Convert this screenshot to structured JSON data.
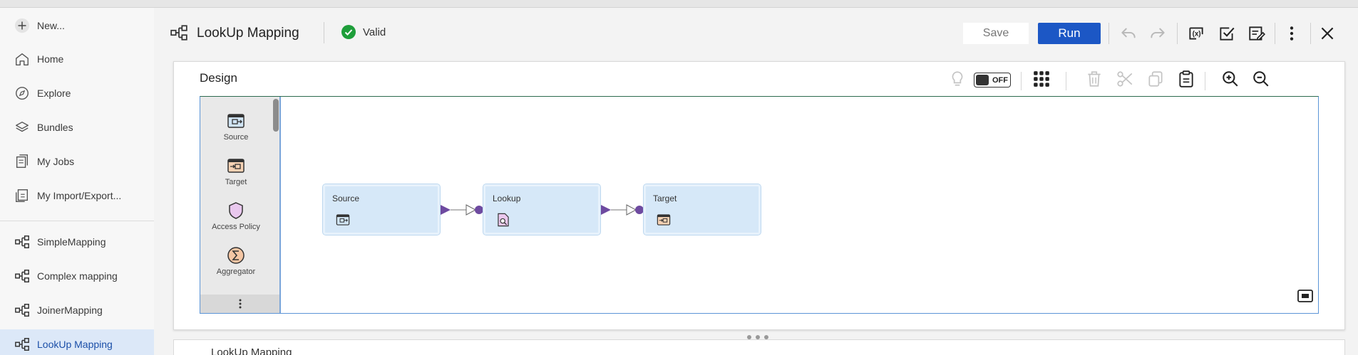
{
  "sidebar": {
    "items": [
      {
        "label": "New...",
        "icon": "plus-icon"
      },
      {
        "label": "Home",
        "icon": "home-icon"
      },
      {
        "label": "Explore",
        "icon": "compass-icon"
      },
      {
        "label": "Bundles",
        "icon": "layers-icon"
      },
      {
        "label": "My Jobs",
        "icon": "jobs-icon"
      },
      {
        "label": "My Import/Export...",
        "icon": "import-export-icon"
      }
    ],
    "mappings": [
      {
        "label": "SimpleMapping",
        "icon": "mapping-icon"
      },
      {
        "label": "Complex mapping",
        "icon": "mapping-icon"
      },
      {
        "label": "JoinerMapping",
        "icon": "mapping-icon"
      },
      {
        "label": "LookUp Mapping",
        "icon": "mapping-icon",
        "active": true
      }
    ]
  },
  "header": {
    "title": "LookUp Mapping",
    "status": "Valid",
    "save_label": "Save",
    "run_label": "Run"
  },
  "design": {
    "title": "Design",
    "toggle_label": "OFF",
    "palette": [
      {
        "label": "Source",
        "icon": "source-icon"
      },
      {
        "label": "Target",
        "icon": "target-icon"
      },
      {
        "label": "Access Policy",
        "icon": "shield-icon"
      },
      {
        "label": "Aggregator",
        "icon": "sigma-icon"
      }
    ],
    "nodes": [
      {
        "label": "Source",
        "icon": "source-icon"
      },
      {
        "label": "Lookup",
        "icon": "lookup-icon"
      },
      {
        "label": "Target",
        "icon": "target-icon"
      }
    ]
  },
  "lower_panel": {
    "title": "LookUp Mapping"
  },
  "colors": {
    "accent": "#1c57c5",
    "valid_green": "#1e9e3a",
    "node_fill": "#d6e8f8",
    "link_purple": "#6e4aa0",
    "active_nav": "#dce8f8"
  }
}
